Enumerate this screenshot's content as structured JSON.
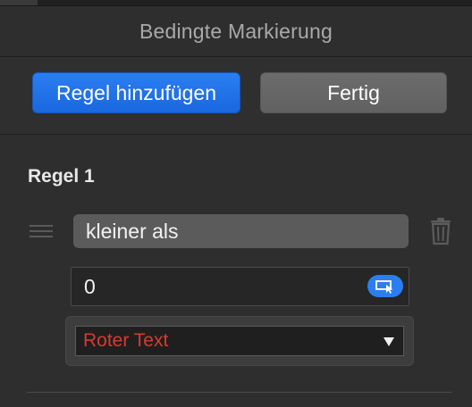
{
  "panel": {
    "title": "Bedingte Markierung"
  },
  "toolbar": {
    "add_rule_label": "Regel hinzufügen",
    "done_label": "Fertig"
  },
  "rule": {
    "heading": "Regel 1",
    "condition": "kleiner als",
    "value": "0",
    "style": "Roter Text"
  },
  "colors": {
    "accent": "#2b7ef2",
    "style_text": "#d83a2e",
    "background": "#2e2e2e"
  },
  "icons": {
    "drag": "drag-handle-icon",
    "delete": "trash-icon",
    "cell_reference": "cell-reference-icon",
    "dropdown": "chevron-down-icon"
  }
}
